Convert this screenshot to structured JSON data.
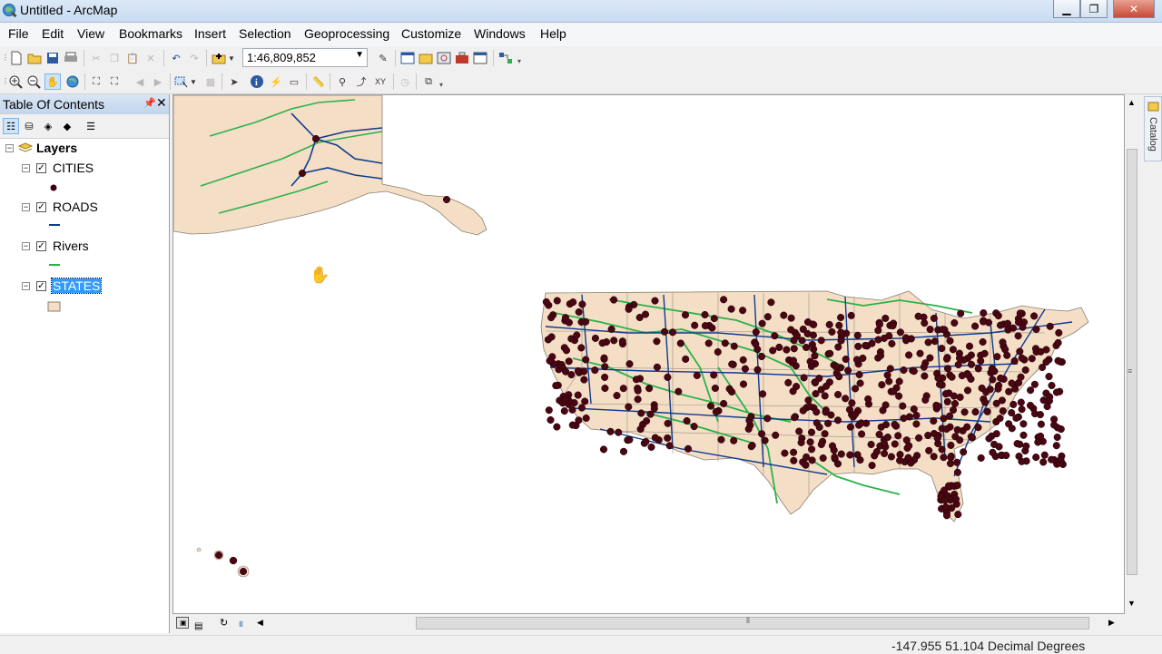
{
  "window": {
    "title": "Untitled - ArcMap"
  },
  "menu": [
    "File",
    "Edit",
    "View",
    "Bookmarks",
    "Insert",
    "Selection",
    "Geoprocessing",
    "Customize",
    "Windows",
    "Help"
  ],
  "toolbar": {
    "scale": "1:46,809,852"
  },
  "toc": {
    "title": "Table Of Contents",
    "root": "Layers",
    "layers": [
      {
        "name": "CITIES",
        "checked": true,
        "symbol": "point",
        "color": "#3a0010"
      },
      {
        "name": "ROADS",
        "checked": true,
        "symbol": "line",
        "color": "#0d3b8e"
      },
      {
        "name": "Rivers",
        "checked": true,
        "symbol": "line",
        "color": "#2ab24a"
      },
      {
        "name": "STATES",
        "checked": true,
        "symbol": "polygon",
        "color": "#f5dec6",
        "selected": true
      }
    ]
  },
  "catalog": {
    "label": "Catalog"
  },
  "status": {
    "coordinates": "-147.955  51.104 Decimal Degrees"
  },
  "colors": {
    "land": "#f5dec6",
    "city": "#4a0612",
    "road": "#0d3b8e",
    "river": "#2ab24a"
  }
}
